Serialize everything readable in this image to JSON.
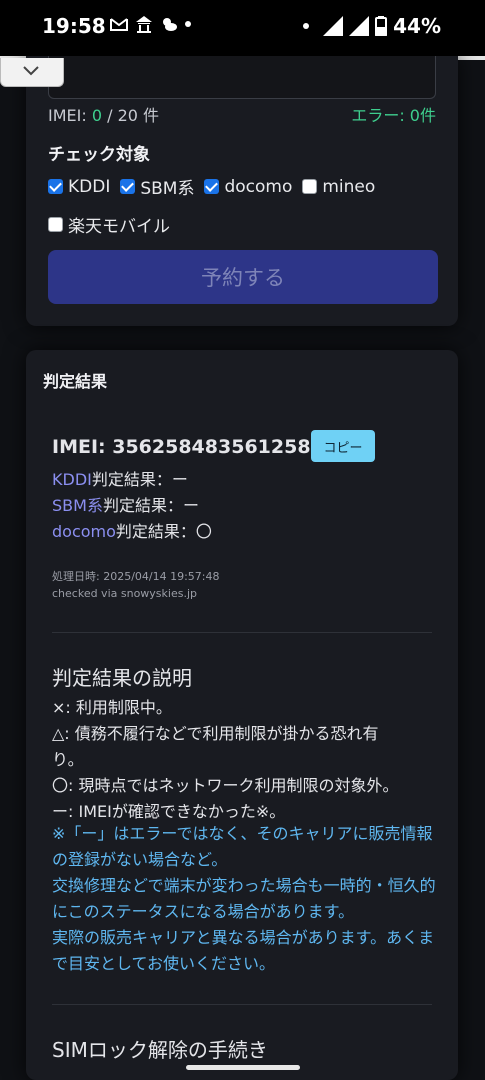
{
  "status_bar": {
    "time": "19:58",
    "battery": "44%",
    "left_icons": [
      "gmail-icon",
      "temple-icon",
      "weather-icon",
      "dot-icon"
    ],
    "right_icons": [
      "dot-icon",
      "wifi-icon",
      "signal-icon",
      "battery-icon"
    ]
  },
  "form": {
    "imei_count_label": "IMEI: ",
    "imei_count_value": "0",
    "imei_count_total": " / 20 件",
    "error_label": "エラー: 0件",
    "check_target_label": "チェック対象",
    "carriers": [
      {
        "label": "KDDI",
        "checked": true
      },
      {
        "label": "SBM系",
        "checked": true
      },
      {
        "label": "docomo",
        "checked": true
      },
      {
        "label": "mineo",
        "checked": false
      },
      {
        "label": "楽天モバイル",
        "checked": false
      }
    ],
    "reserve_button": "予約する"
  },
  "result": {
    "section_title": "判定結果",
    "imei_text": "IMEI: 356258483561258",
    "copy_button": "コピー",
    "lines": [
      {
        "carrier": "KDDI",
        "suffix": "判定結果：ー"
      },
      {
        "carrier": "SBM系",
        "suffix": "判定結果：ー"
      },
      {
        "carrier": "docomo",
        "suffix": "判定結果：〇"
      }
    ],
    "processed_at": "処理日時: 2025/04/14 19:57:48",
    "checked_via": "checked via snowyskies.jp"
  },
  "explanation": {
    "title": "判定結果の説明",
    "items": [
      "×: 利用制限中。",
      "△: 債務不履行などで利用制限が掛かる恐れ有",
      "り。",
      "〇: 現時点ではネットワーク利用制限の対象外。",
      "ー: IMEIが確認できなかった※。"
    ],
    "note_1": "※「ー」はエラーではなく、そのキャリアに販売情報の登録がない場合など。",
    "note_2": "交換修理などで端末が変わった場合も一時的・恒久的にこのステータスになる場合があります。",
    "note_3": "実際の販売キャリアと異なる場合があります。あくまで目安としてお使いください。"
  },
  "sim_section": {
    "title": "SIMロック解除の手続き"
  },
  "colors": {
    "accent_green": "#3ecf8e",
    "button_bg": "#2d3588",
    "link_purple": "#8b8ff0",
    "note_blue": "#5fb7f0",
    "copy_bg": "#6fd1f5"
  }
}
